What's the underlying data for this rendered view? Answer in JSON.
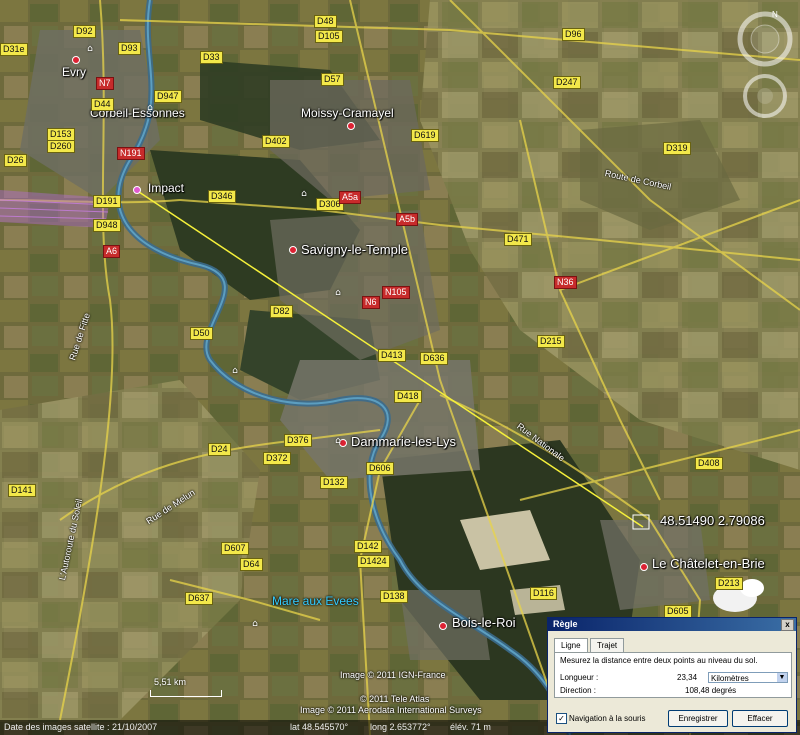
{
  "map": {
    "towns": [
      {
        "name": "Evry",
        "style": "normal"
      },
      {
        "name": "Corbeil-Essonnes",
        "style": "normal"
      },
      {
        "name": "Moissy-Cramayel",
        "style": "normal"
      },
      {
        "name": "Savigny-le-Temple",
        "style": "big"
      },
      {
        "name": "Dammarie-les-Lys",
        "style": "big"
      },
      {
        "name": "Le Châtelet-en-Brie",
        "style": "big"
      },
      {
        "name": "Bois-le-Roi",
        "style": "big"
      },
      {
        "name": "Impact",
        "style": "normal"
      }
    ],
    "roads": [
      "D92",
      "D93",
      "D33",
      "D48",
      "D105",
      "D57",
      "D96",
      "D247",
      "D319",
      "D44",
      "D947",
      "D153",
      "D260",
      "D26",
      "N7",
      "N191",
      "D402",
      "D619",
      "D346",
      "D306",
      "A5a",
      "A5b",
      "D471",
      "D191",
      "D948",
      "A6",
      "N36",
      "N6",
      "N105",
      "D82",
      "D50",
      "D215",
      "D413",
      "D636",
      "D418",
      "D24",
      "D376",
      "D372",
      "D606",
      "D132",
      "D141",
      "D607",
      "D64",
      "D142",
      "D1424",
      "D138",
      "D116",
      "D637",
      "D408",
      "D213",
      "D605",
      "D31e"
    ],
    "red_roads": [
      "N7",
      "N191",
      "A5a",
      "A5b",
      "A6",
      "N36",
      "N6",
      "N105"
    ],
    "streets": [
      "Route de Corbeil",
      "Rue de Fitte",
      "Rue Nationale",
      "Rue de Melun",
      "L'Autoroute du Soleil"
    ],
    "water_label": "Mare aux Evees",
    "placemark_coords": "48.51490 2.79086",
    "scale": "5,51 km",
    "credits": [
      "Image © 2011 IGN-France",
      "© 2011 Tele Atlas",
      "Image © 2011 Aerodata International Surveys"
    ],
    "compass_letter": "N"
  },
  "status": {
    "imagery_date": "Date des images satellite : 21/10/2007",
    "lat": "lat   48.545570°",
    "lon": "long   2.653772°",
    "elev": "élév.   71 m"
  },
  "regle": {
    "title": "Règle",
    "close": "x",
    "tabs": [
      "Ligne",
      "Trajet"
    ],
    "description": "Mesurez la distance entre deux points au niveau du sol.",
    "length_label": "Longueur :",
    "length_value": "23,34",
    "unit_selected": "Kilomètres",
    "direction_label": "Direction :",
    "direction_value": "108,48 degrés",
    "nav_checkbox_label": "Navigation à la souris",
    "nav_checked": true,
    "save_button": "Enregistrer",
    "clear_button": "Effacer"
  },
  "colors": {
    "measure_line": "#f5f03a",
    "ruler_title": "#0a246a"
  }
}
